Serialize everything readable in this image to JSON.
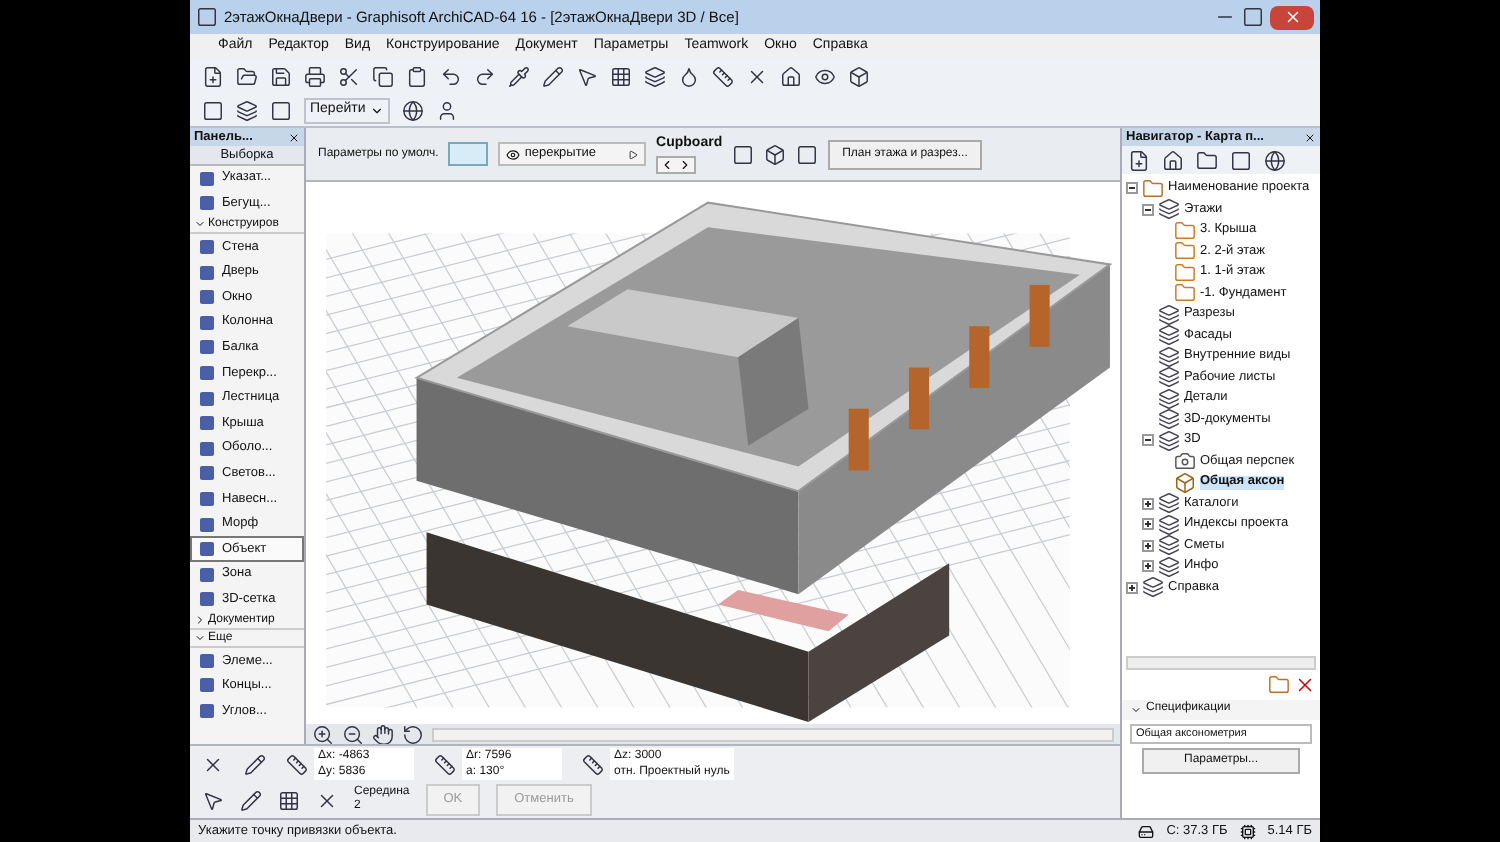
{
  "window": {
    "title": "2этажОкнаДвери - Graphisoft ArchiCAD-64 16 - [2этажОкнаДвери 3D / Все]"
  },
  "menu": [
    "Файл",
    "Редактор",
    "Вид",
    "Конструирование",
    "Документ",
    "Параметры",
    "Teamwork",
    "Окно",
    "Справка"
  ],
  "toolbar": {
    "goto": "Перейти"
  },
  "info_box": {
    "label": "Параметры по умолч.",
    "layer": "перекрытие",
    "object": "Cupboard",
    "view_button": "План этажа и разрез..."
  },
  "toolbox": {
    "title": "Панель...",
    "select_tab": "Выборка",
    "items": [
      {
        "kind": "tool",
        "label": "Указат...",
        "selected": false
      },
      {
        "kind": "tool",
        "label": "Бегущ...",
        "selected": false
      },
      {
        "kind": "section",
        "label": "Конструиров",
        "expanded": true
      },
      {
        "kind": "tool",
        "label": "Стена",
        "selected": false
      },
      {
        "kind": "tool",
        "label": "Дверь",
        "selected": false
      },
      {
        "kind": "tool",
        "label": "Окно",
        "selected": false
      },
      {
        "kind": "tool",
        "label": "Колонна",
        "selected": false
      },
      {
        "kind": "tool",
        "label": "Балка",
        "selected": false
      },
      {
        "kind": "tool",
        "label": "Перекр...",
        "selected": false
      },
      {
        "kind": "tool",
        "label": "Лестница",
        "selected": false
      },
      {
        "kind": "tool",
        "label": "Крыша",
        "selected": false
      },
      {
        "kind": "tool",
        "label": "Оболо...",
        "selected": false
      },
      {
        "kind": "tool",
        "label": "Светов...",
        "selected": false
      },
      {
        "kind": "tool",
        "label": "Навесн...",
        "selected": false
      },
      {
        "kind": "tool",
        "label": "Морф",
        "selected": false
      },
      {
        "kind": "tool",
        "label": "Объект",
        "selected": true
      },
      {
        "kind": "tool",
        "label": "Зона",
        "selected": false
      },
      {
        "kind": "tool",
        "label": "3D-сетка",
        "selected": false
      },
      {
        "kind": "section",
        "label": "Документир",
        "expanded": false
      },
      {
        "kind": "section",
        "label": "Еще",
        "expanded": true
      },
      {
        "kind": "tool",
        "label": "Элеме...",
        "selected": false
      },
      {
        "kind": "tool",
        "label": "Концы...",
        "selected": false
      },
      {
        "kind": "tool",
        "label": "Углов...",
        "selected": false
      }
    ]
  },
  "navigator": {
    "title": "Навигатор - Карта п...",
    "tree": [
      {
        "label": "Наименование проекта",
        "kind": "project",
        "expanded": true,
        "selected": false,
        "children": [
          {
            "label": "Этажи",
            "kind": "folder",
            "expanded": true,
            "selected": false,
            "children": [
              {
                "label": "3. Крыша",
                "kind": "story",
                "selected": false
              },
              {
                "label": "2. 2-й этаж",
                "kind": "story",
                "selected": false
              },
              {
                "label": "1. 1-й этаж",
                "kind": "story",
                "selected": false
              },
              {
                "label": "-1. Фундамент",
                "kind": "story",
                "selected": false
              }
            ]
          },
          {
            "label": "Разрезы",
            "kind": "folder",
            "selected": false
          },
          {
            "label": "Фасады",
            "kind": "folder",
            "selected": false
          },
          {
            "label": "Внутренние виды",
            "kind": "folder",
            "selected": false
          },
          {
            "label": "Рабочие листы",
            "kind": "folder",
            "selected": false
          },
          {
            "label": "Детали",
            "kind": "folder",
            "selected": false
          },
          {
            "label": "3D-документы",
            "kind": "folder",
            "selected": false
          },
          {
            "label": "3D",
            "kind": "folder",
            "expanded": true,
            "selected": false,
            "children": [
              {
                "label": "Общая перспек",
                "kind": "camera",
                "selected": false
              },
              {
                "label": "Общая аксон",
                "kind": "axon",
                "selected": true
              }
            ]
          },
          {
            "label": "Каталоги",
            "kind": "folder",
            "expanded": false,
            "selected": false
          },
          {
            "label": "Индексы проекта",
            "kind": "folder",
            "expanded": false,
            "selected": false
          },
          {
            "label": "Сметы",
            "kind": "folder",
            "expanded": false,
            "selected": false
          },
          {
            "label": "Инфо",
            "kind": "folder",
            "expanded": false,
            "selected": false
          }
        ]
      },
      {
        "label": "Справка",
        "kind": "folder",
        "expanded": false,
        "selected": false
      }
    ],
    "section": "Спецификации",
    "view_name": "Общая аксонометрия",
    "params_button": "Параметры..."
  },
  "coords": {
    "fields": [
      {
        "label": "Δx:",
        "value": "-4863"
      },
      {
        "label": "Δy:",
        "value": "5836"
      },
      {
        "label": "Δr:",
        "value": "7596"
      },
      {
        "label": "a:",
        "value": "130°"
      },
      {
        "label": "Δz:",
        "value": "3000"
      },
      {
        "label": "отн.",
        "value": "Проектный нуль"
      }
    ],
    "snap": {
      "label": "Середина",
      "value": "2"
    },
    "buttons": [
      {
        "label": "OK",
        "disabled": true
      },
      {
        "label": "Отменить",
        "disabled": true
      }
    ]
  },
  "status_bar": {
    "hint": "Укажите точку привязки объекта.",
    "disk": "C: 37.3 ГБ",
    "memory": "5.14 ГБ"
  }
}
